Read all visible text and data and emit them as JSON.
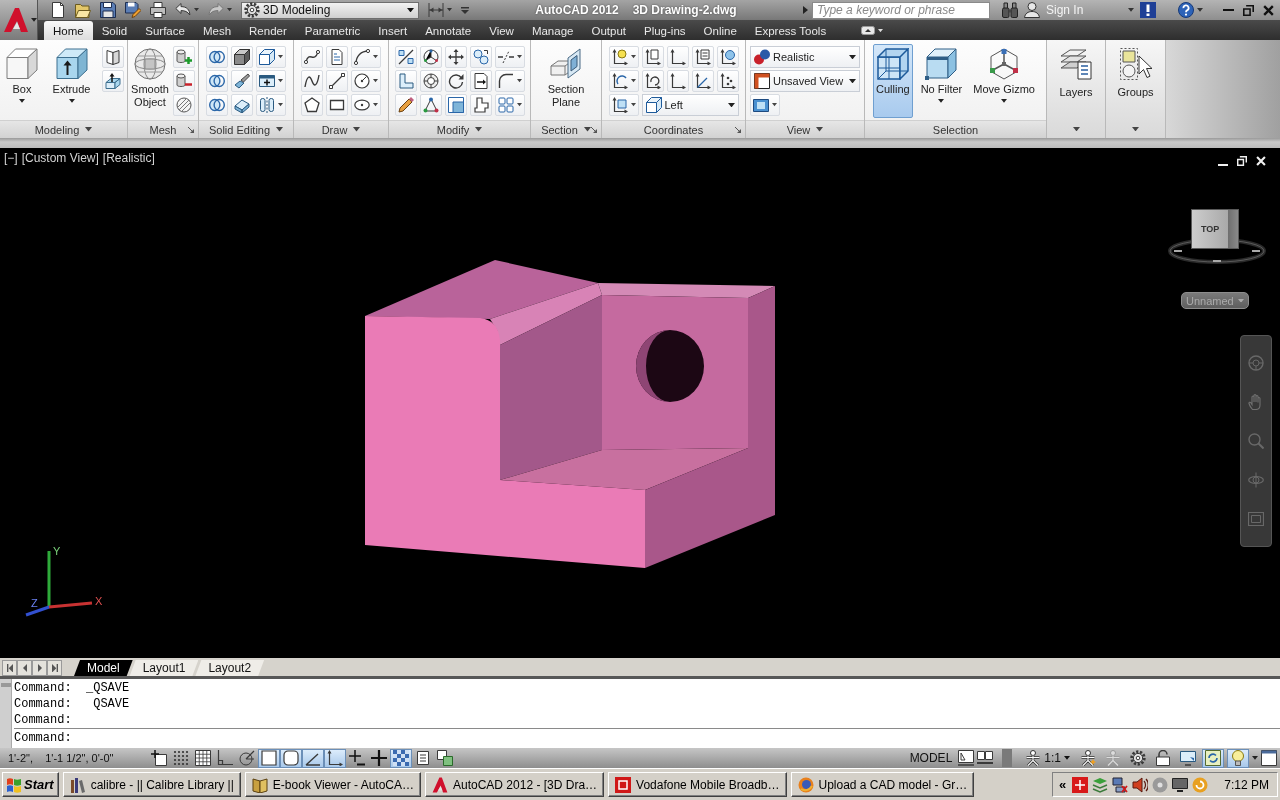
{
  "window": {
    "app": "AutoCAD 2012",
    "document": "3D Drawing-2.dwg"
  },
  "quick_access": {
    "workspace": "3D Modeling"
  },
  "search": {
    "placeholder": "Type a keyword or phrase"
  },
  "account": {
    "label": "Sign In"
  },
  "ribbon_tabs": [
    {
      "label": "Home",
      "selected": true
    },
    {
      "label": "Solid",
      "selected": false
    },
    {
      "label": "Surface",
      "selected": false
    },
    {
      "label": "Mesh",
      "selected": false
    },
    {
      "label": "Render",
      "selected": false
    },
    {
      "label": "Parametric",
      "selected": false
    },
    {
      "label": "Insert",
      "selected": false
    },
    {
      "label": "Annotate",
      "selected": false
    },
    {
      "label": "View",
      "selected": false
    },
    {
      "label": "Manage",
      "selected": false
    },
    {
      "label": "Output",
      "selected": false
    },
    {
      "label": "Plug-ins",
      "selected": false
    },
    {
      "label": "Online",
      "selected": false
    },
    {
      "label": "Express Tools",
      "selected": false
    }
  ],
  "ribbon_panels": [
    {
      "kind": "tools",
      "title": "Modeling",
      "expander": true,
      "launcher": false,
      "large_buttons": [
        {
          "label": "Box",
          "dropdown": true
        },
        {
          "label": "Extrude",
          "dropdown": true
        }
      ]
    },
    {
      "kind": "tools",
      "title": "Mesh",
      "expander": false,
      "launcher": true,
      "large_buttons": [
        {
          "label": "Smooth Object",
          "dropdown": false
        }
      ]
    },
    {
      "kind": "tools",
      "title": "Solid Editing",
      "expander": true,
      "launcher": false
    },
    {
      "kind": "tools",
      "title": "Draw",
      "expander": true,
      "launcher": false
    },
    {
      "kind": "tools",
      "title": "Modify",
      "expander": true,
      "launcher": false
    },
    {
      "kind": "tools",
      "title": "Section",
      "expander": true,
      "launcher": true,
      "large_buttons": [
        {
          "label": "Section Plane",
          "dropdown": false
        }
      ]
    },
    {
      "kind": "tools",
      "title": "Coordinates",
      "expander": false,
      "launcher": true,
      "dropdowns": [
        {
          "value": "Left"
        }
      ]
    },
    {
      "kind": "tools",
      "title": "View",
      "expander": true,
      "launcher": false,
      "dropdowns": [
        {
          "value": "Realistic"
        },
        {
          "value": "Unsaved View"
        }
      ]
    },
    {
      "kind": "tools",
      "title": "Selection",
      "expander": false,
      "launcher": false,
      "large_buttons": [
        {
          "label": "Culling",
          "dropdown": false,
          "on": true
        },
        {
          "label": "No Filter",
          "dropdown": true,
          "on": false
        },
        {
          "label": "Move Gizmo",
          "dropdown": true,
          "on": false
        }
      ]
    },
    {
      "kind": "collapsed",
      "label": "Layers"
    },
    {
      "kind": "collapsed",
      "label": "Groups"
    }
  ],
  "viewport": {
    "controls": [
      "[−]",
      "[Custom View]",
      "[Realistic]"
    ],
    "viewcube_face": "TOP",
    "ucs_menu": "Unnamed",
    "axis_labels": [
      "Y",
      "X",
      "Z"
    ]
  },
  "layout_tabs": [
    {
      "label": "Model",
      "selected": true
    },
    {
      "label": "Layout1",
      "selected": false
    },
    {
      "label": "Layout2",
      "selected": false
    }
  ],
  "command_line": {
    "history": [
      "Command:  _QSAVE",
      "Command:   QSAVE",
      "Command:"
    ],
    "prompt": "Command:"
  },
  "status_bar": {
    "coordinates": "1'-2\",    1'-1 1/2\", 0'-0\"",
    "toggles": [
      {
        "on": false
      },
      {
        "on": false
      },
      {
        "on": false
      },
      {
        "on": false
      },
      {
        "on": false
      },
      {
        "on": true
      },
      {
        "on": true
      },
      {
        "on": true
      },
      {
        "on": true
      },
      {
        "on": false
      },
      {
        "on": false
      },
      {
        "on": true
      },
      {
        "on": false
      },
      {
        "on": false
      }
    ],
    "space": "MODEL",
    "annotation_scale": "1:1",
    "right_toggles": [
      {
        "on": false
      },
      {
        "on": false
      },
      {
        "on": false
      },
      {
        "on": false
      },
      {
        "on": false
      },
      {
        "on": true
      },
      {
        "on": true
      }
    ]
  },
  "taskbar": {
    "start": "Start",
    "tasks": [
      {
        "label": "calibre - || Calibre Library ||"
      },
      {
        "label": "E-book Viewer - AutoCA…"
      },
      {
        "label": "AutoCAD 2012 - [3D Dra…"
      },
      {
        "label": "Vodafone Mobile Broadb…"
      },
      {
        "label": "Upload a CAD model - Gr…"
      }
    ],
    "tray_toggle": "«",
    "clock": "7:12 PM"
  }
}
